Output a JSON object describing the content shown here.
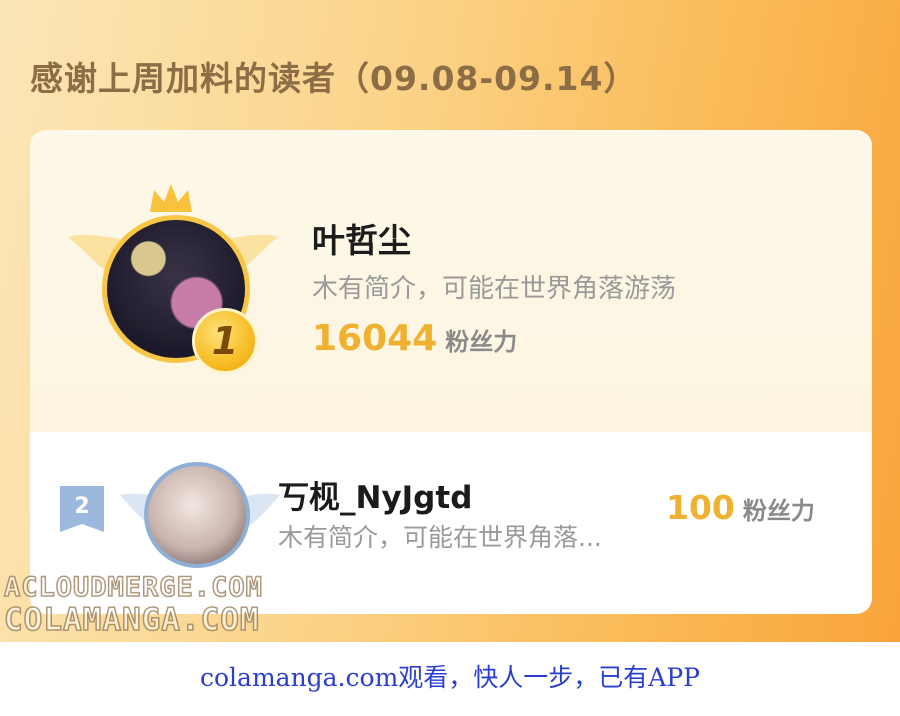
{
  "header": {
    "title": "感谢上周加料的读者（09.08-09.14）"
  },
  "ranking": [
    {
      "rank": "1",
      "name": "叶哲尘",
      "description": "木有简介，可能在世界角落游荡",
      "score": "16044",
      "unit": "粉丝力"
    },
    {
      "rank": "2",
      "name": "丂枧_NyJgtd",
      "description": "木有简介，可能在世界角落...",
      "score": "100",
      "unit": "粉丝力"
    }
  ],
  "watermarks": [
    "ACLOUDMERGE.COM",
    "COLAMANGA.COM"
  ],
  "footer": {
    "text": "colamanga.com观看，快人一步，已有APP"
  },
  "colors": {
    "accent": "#f1b130",
    "gold": "#f9c545",
    "silver": "#8fb0d6",
    "footer_link": "#2a3fd0"
  },
  "icons": [
    "crown-icon",
    "wings-icon",
    "rank-badge-gold",
    "rank-badge-silver"
  ]
}
